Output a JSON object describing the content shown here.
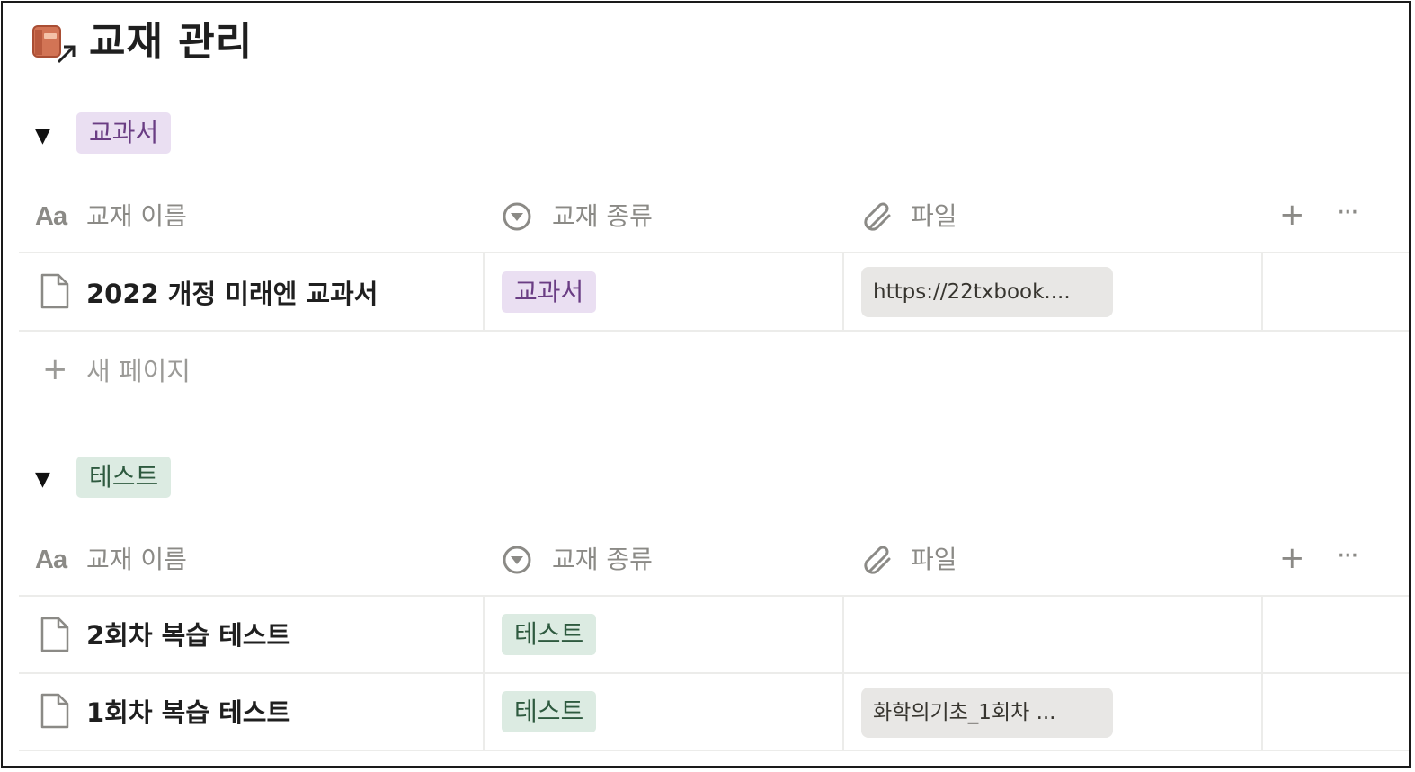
{
  "page": {
    "title": "교재 관리",
    "icon": "book-link-icon"
  },
  "colors": {
    "textbook_tag_bg": "#eadff2",
    "textbook_tag_fg": "#6a3d84",
    "test_tag_bg": "#dcebe2",
    "test_tag_fg": "#2e5a3f",
    "muted": "#8b8a86",
    "file_chip_bg": "#e8e7e5"
  },
  "columns": {
    "name": "교재 이름",
    "name_icon": "Aa",
    "type": "교재 종류",
    "type_icon": "select-icon",
    "file": "파일",
    "file_icon": "paperclip-icon",
    "add": "+",
    "more": "···"
  },
  "groups": [
    {
      "label": "교과서",
      "rows": [
        {
          "name": "2022 개정 미래엔 교과서",
          "type": "교과서",
          "file": "https://22txbook...."
        }
      ],
      "new_page": "새 페이지"
    },
    {
      "label": "테스트",
      "rows": [
        {
          "name": "2회차 복습 테스트",
          "type": "테스트",
          "file": ""
        },
        {
          "name": "1회차 복습 테스트",
          "type": "테스트",
          "file": "화학의기초_1회차 ..."
        }
      ]
    }
  ]
}
